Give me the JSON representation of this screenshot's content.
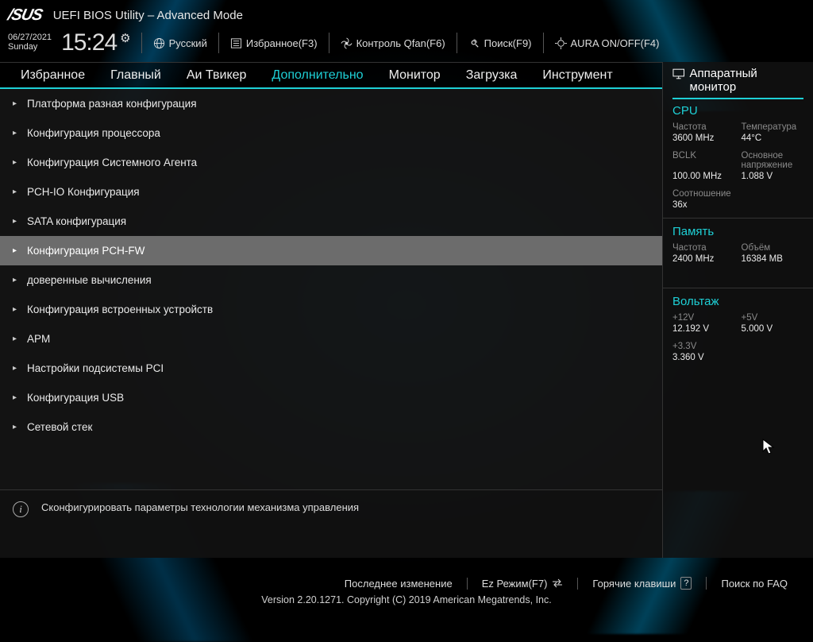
{
  "brand": "/SUS",
  "title": "UEFI BIOS Utility – Advanced Mode",
  "header": {
    "date": "06/27/2021",
    "day": "Sunday",
    "time": "15:24",
    "language": "Русский",
    "favorites": "Избранное(F3)",
    "qfan": "Контроль Qfan(F6)",
    "search": "Поиск(F9)",
    "aura": "AURA ON/OFF(F4)"
  },
  "tabs": [
    "Избранное",
    "Главный",
    "Аи Твикер",
    "Дополнительно",
    "Монитор",
    "Загрузка",
    "Инструмент"
  ],
  "active_tab": 3,
  "menu": [
    "Платформа разная конфигурация",
    "Конфигурация процессора",
    "Конфигурация Системного Агента",
    "PCH-IO Конфигурация",
    "SATA конфигурация",
    "Конфигурация PCH-FW",
    "доверенные вычисления",
    "Конфигурация встроенных устройств",
    "APM",
    "Настройки подсистемы PCI",
    "Конфигурация USB",
    "Сетевой стек"
  ],
  "selected_index": 5,
  "help_text": "Сконфигурировать параметры технологии механизма управления",
  "side": {
    "title": "Аппаратный монитор",
    "cpu": {
      "title": "CPU",
      "freq_label": "Частота",
      "freq": "3600 MHz",
      "temp_label": "Температура",
      "temp": "44°C",
      "bclk_label": "BCLK",
      "bclk": "100.00 MHz",
      "vcore_label": "Основное напряжение",
      "vcore": "1.088 V",
      "ratio_label": "Соотношение",
      "ratio": "36x"
    },
    "mem": {
      "title": "Память",
      "freq_label": "Частота",
      "freq": "2400 MHz",
      "cap_label": "Объём",
      "cap": "16384 MB"
    },
    "volt": {
      "title": "Вольтаж",
      "v12_label": "+12V",
      "v12": "12.192 V",
      "v5_label": "+5V",
      "v5": "5.000 V",
      "v33_label": "+3.3V",
      "v33": "3.360 V"
    }
  },
  "footer": {
    "last_mod": "Последнее изменение",
    "ez_mode": "Ez Режим(F7)",
    "hotkeys": "Горячие клавиши",
    "faq": "Поиск по FAQ",
    "copyright": "Version 2.20.1271. Copyright (C) 2019 American Megatrends, Inc."
  }
}
